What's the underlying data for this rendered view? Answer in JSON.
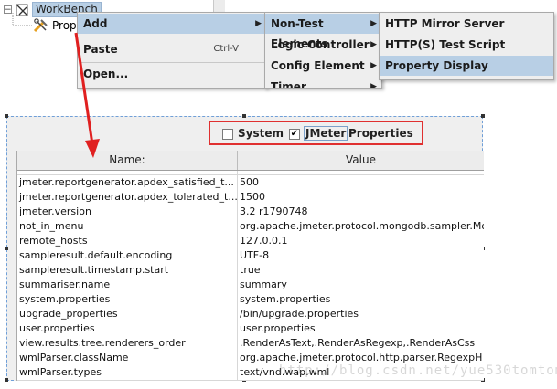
{
  "tree": {
    "root_label": "WorkBench",
    "child_label": "Prop",
    "toggle_symbol": "−"
  },
  "context_menu": {
    "items": [
      {
        "label": "Add",
        "arrow": "▶",
        "accel": ""
      },
      {
        "label": "Paste",
        "arrow": "",
        "accel": "Ctrl-V"
      },
      {
        "label": "Open...",
        "arrow": "",
        "accel": ""
      }
    ]
  },
  "add_submenu": {
    "items": [
      {
        "label": "Non-Test Elements",
        "arrow": "▶"
      },
      {
        "label": "Logic Controller",
        "arrow": "▶"
      },
      {
        "label": "Config Element",
        "arrow": "▶"
      },
      {
        "label": "Timer",
        "arrow": "▶"
      }
    ]
  },
  "non_test_submenu": {
    "items": [
      {
        "label": "HTTP Mirror Server"
      },
      {
        "label": "HTTP(S) Test Script Recorder"
      },
      {
        "label": "Property Display"
      }
    ]
  },
  "property_display": {
    "system_label": "System",
    "system_checked": false,
    "jmeter_label": "JMeter",
    "jmeter_checked": true,
    "jmeter_check_glyph": "✔",
    "properties_label": "Properties",
    "columns": {
      "name": "Name:",
      "value": "Value"
    },
    "rows": [
      {
        "name": "jmeter.reportgenerator.apdex_satisfied_t...",
        "value": "500"
      },
      {
        "name": "jmeter.reportgenerator.apdex_tolerated_t...",
        "value": "1500"
      },
      {
        "name": "jmeter.version",
        "value": "3.2 r1790748"
      },
      {
        "name": "not_in_menu",
        "value": "org.apache.jmeter.protocol.mongodb.sampler.Mo"
      },
      {
        "name": "remote_hosts",
        "value": "127.0.0.1"
      },
      {
        "name": "sampleresult.default.encoding",
        "value": "UTF-8"
      },
      {
        "name": "sampleresult.timestamp.start",
        "value": "true"
      },
      {
        "name": "summariser.name",
        "value": "summary"
      },
      {
        "name": "system.properties",
        "value": "system.properties"
      },
      {
        "name": "upgrade_properties",
        "value": "/bin/upgrade.properties"
      },
      {
        "name": "user.properties",
        "value": "user.properties"
      },
      {
        "name": "view.results.tree.renderers_order",
        "value": ".RenderAsText,.RenderAsRegexp,.RenderAsCss"
      },
      {
        "name": "wmlParser.className",
        "value": "org.apache.jmeter.protocol.http.parser.RegexpH"
      },
      {
        "name": "wmlParser.types",
        "value": "text/vnd.wap.wml"
      }
    ]
  },
  "watermark": "http://blog.csdn.net/yue530tomtom",
  "colors": {
    "selection": "#b8cfe5",
    "highlight_box": "#e03030",
    "annotation_arrow": "#e02020",
    "panel_border": "#6f9fd8"
  }
}
